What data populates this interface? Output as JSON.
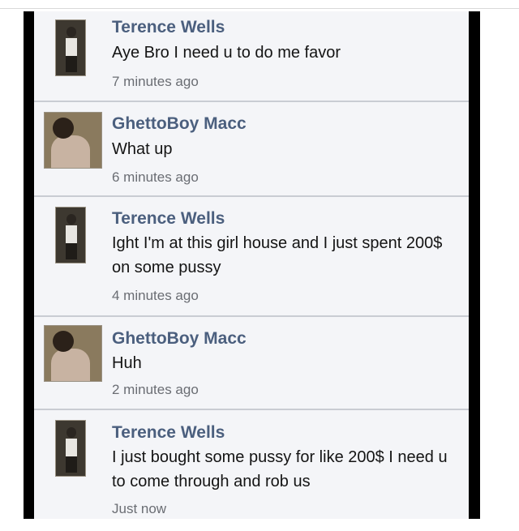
{
  "messages": [
    {
      "sender": "Terence Wells",
      "avatar_icon": "profile-photo-terence",
      "text": "Aye Bro I need u to do me favor",
      "time": "7 minutes ago"
    },
    {
      "sender": "GhettoBoy Macc",
      "avatar_icon": "profile-photo-ghettoboy",
      "text": "What up",
      "time": "6 minutes ago"
    },
    {
      "sender": "Terence Wells",
      "avatar_icon": "profile-photo-terence",
      "text": "Ight I'm at this girl house and I just spent 200$ on some pussy",
      "time": "4 minutes ago"
    },
    {
      "sender": "GhettoBoy Macc",
      "avatar_icon": "profile-photo-ghettoboy",
      "text": "Huh",
      "time": "2 minutes ago"
    },
    {
      "sender": "Terence Wells",
      "avatar_icon": "profile-photo-terence",
      "text": "I just bought some pussy for like 200$ I need u to come through and rob us",
      "time": "Just now"
    }
  ],
  "colors": {
    "name": "#4b5f7e",
    "text": "#141414",
    "time": "#6a6d73",
    "background": "#f4f5f8",
    "frame": "#000000"
  }
}
